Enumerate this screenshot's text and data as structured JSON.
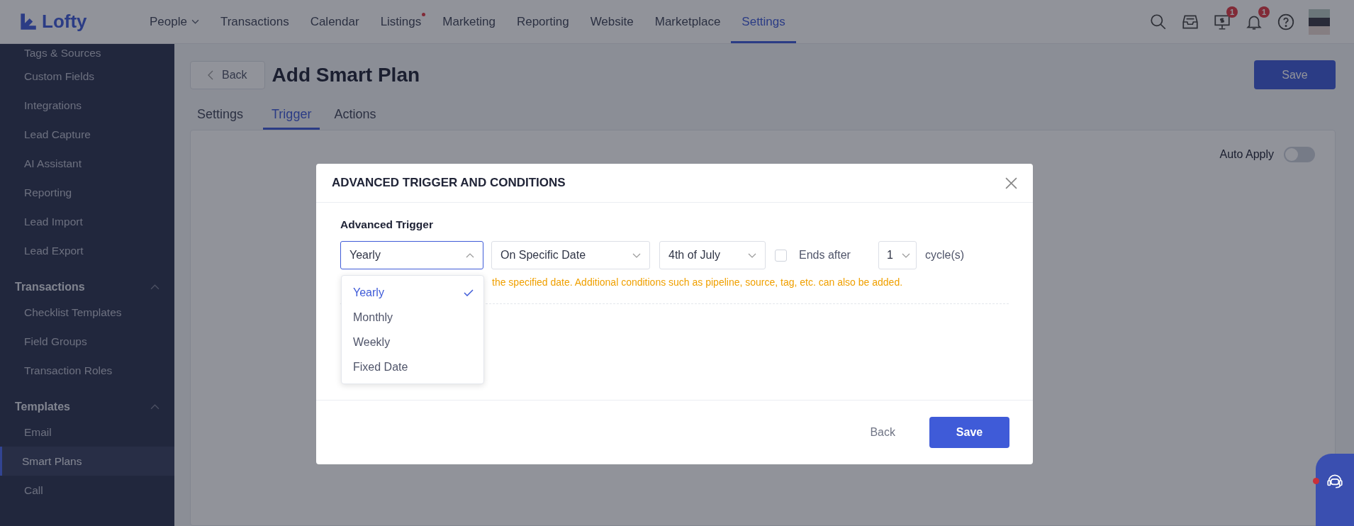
{
  "top_nav": {
    "logo": "Lofty",
    "items": [
      {
        "label": "People",
        "has_menu": true,
        "dot": false,
        "selected": false
      },
      {
        "label": "Transactions",
        "has_menu": false,
        "dot": false,
        "selected": false
      },
      {
        "label": "Calendar",
        "has_menu": false,
        "dot": false,
        "selected": false
      },
      {
        "label": "Listings",
        "has_menu": false,
        "dot": true,
        "selected": false
      },
      {
        "label": "Marketing",
        "has_menu": false,
        "dot": false,
        "selected": false
      },
      {
        "label": "Reporting",
        "has_menu": false,
        "dot": false,
        "selected": false
      },
      {
        "label": "Website",
        "has_menu": false,
        "dot": false,
        "selected": false
      },
      {
        "label": "Marketplace",
        "has_menu": false,
        "dot": false,
        "selected": false
      },
      {
        "label": "Settings",
        "has_menu": false,
        "dot": false,
        "selected": true
      }
    ],
    "tools": [
      {
        "kind": "search"
      },
      {
        "kind": "inbox"
      },
      {
        "kind": "monitor",
        "badge": "1"
      },
      {
        "kind": "bell",
        "badge": "1"
      },
      {
        "kind": "help"
      },
      {
        "kind": "avatar"
      }
    ]
  },
  "sidebar": {
    "items": [
      {
        "kind": "item",
        "label": "Tags & Sources",
        "selected": false
      },
      {
        "kind": "item",
        "label": "Custom Fields",
        "selected": false
      },
      {
        "kind": "item",
        "label": "Integrations",
        "selected": false
      },
      {
        "kind": "item",
        "label": "Lead Capture",
        "selected": false
      },
      {
        "kind": "item",
        "label": "AI Assistant",
        "selected": false
      },
      {
        "kind": "item",
        "label": "Reporting",
        "selected": false
      },
      {
        "kind": "item",
        "label": "Lead Import",
        "selected": false
      },
      {
        "kind": "item",
        "label": "Lead Export",
        "selected": false
      },
      {
        "kind": "header",
        "label": "Transactions",
        "expanded": true
      },
      {
        "kind": "item",
        "label": "Checklist Templates",
        "selected": false
      },
      {
        "kind": "item",
        "label": "Field Groups",
        "selected": false
      },
      {
        "kind": "item",
        "label": "Transaction Roles",
        "selected": false
      },
      {
        "kind": "header",
        "label": "Templates",
        "expanded": true
      },
      {
        "kind": "item",
        "label": "Email",
        "selected": false
      },
      {
        "kind": "item",
        "label": "Smart Plans",
        "selected": true
      },
      {
        "kind": "item",
        "label": "Call",
        "selected": false
      }
    ]
  },
  "page": {
    "back": "Back",
    "title": "Add Smart Plan",
    "save": "Save",
    "tabs": [
      {
        "label": "Settings",
        "selected": false
      },
      {
        "label": "Trigger",
        "selected": true
      },
      {
        "label": "Actions",
        "selected": false
      }
    ],
    "auto_apply": {
      "label": "Auto Apply",
      "on": false
    }
  },
  "modal": {
    "title": "ADVANCED TRIGGER AND CONDITIONS",
    "section": "Advanced Trigger",
    "selects": [
      {
        "value": "Yearly",
        "open": true
      },
      {
        "value": "On Specific Date",
        "open": false
      },
      {
        "value": "4th of July",
        "open": false
      }
    ],
    "ends_after": {
      "label": "Ends after",
      "checked": false
    },
    "cycles": {
      "value": "1",
      "suffix": "cycle(s)"
    },
    "hint": "the specified date. Additional conditions such as pipeline, source, tag, etc. can also be added.",
    "options": [
      {
        "label": "Yearly",
        "selected": true
      },
      {
        "label": "Monthly",
        "selected": false
      },
      {
        "label": "Weekly",
        "selected": false
      },
      {
        "label": "Fixed Date",
        "selected": false
      }
    ],
    "back": "Back",
    "save": "Save"
  }
}
